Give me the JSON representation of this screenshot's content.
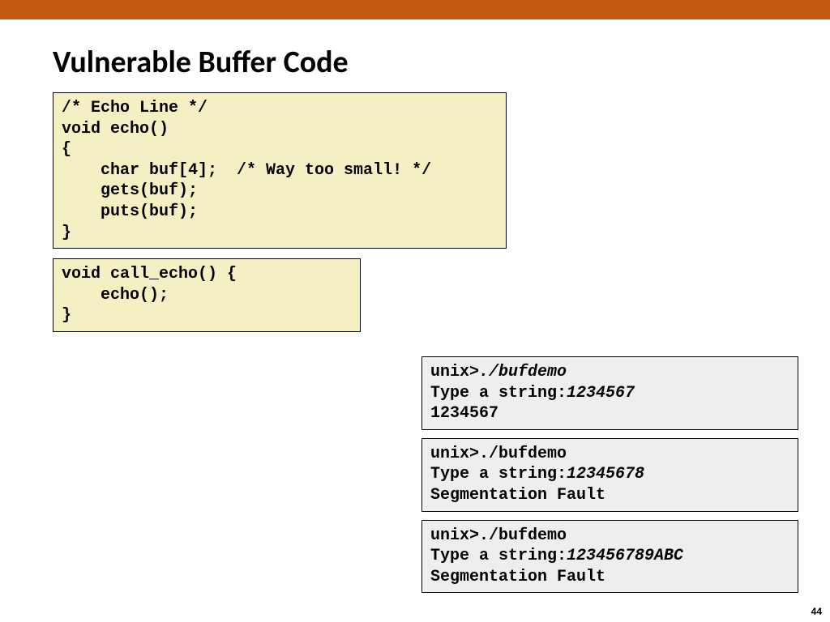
{
  "title": "Vulnerable Buffer Code",
  "page_number": "44",
  "code_echo": {
    "l1": "/* Echo Line */",
    "l2": "void echo()",
    "l3": "{",
    "l4": "    char buf[4];  /* Way too small! */",
    "l5": "    gets(buf);",
    "l6": "    puts(buf);",
    "l7": "}"
  },
  "code_callecho": {
    "l1": "void call_echo() {",
    "l2": "    echo();",
    "l3": "}"
  },
  "term1": {
    "prompt": "unix>",
    "cmd": "./bufdemo",
    "label": "Type a string:",
    "input": "1234567",
    "output": "1234567"
  },
  "term2": {
    "prompt": "unix>",
    "cmd": "./bufdemo",
    "label": "Type a string:",
    "input": "12345678",
    "output": "Segmentation Fault"
  },
  "term3": {
    "prompt": "unix>",
    "cmd": "./bufdemo",
    "label": "Type a string:",
    "input": "123456789ABC",
    "output": "Segmentation Fault"
  }
}
